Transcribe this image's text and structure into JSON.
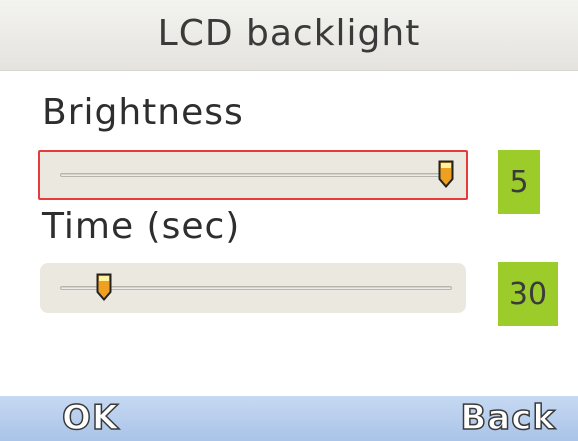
{
  "title": "LCD backlight",
  "brightness": {
    "label": "Brightness",
    "value": "5",
    "level": 5,
    "min": 1,
    "max": 5,
    "selected": true
  },
  "time": {
    "label": "Time (sec)",
    "value": "30",
    "level_fraction": 0.1
  },
  "softkeys": {
    "left": "OK",
    "right": "Back"
  },
  "colors": {
    "title_bg": "#e9e8e3",
    "slider_bg": "#ebe9df",
    "selection_border": "#e53b3b",
    "value_bg": "#9ccc2a",
    "thumb_fill": "#f0a020",
    "softkey_bg": "#b5cdee"
  },
  "icons": {
    "thumb": "slider-thumb-icon"
  }
}
